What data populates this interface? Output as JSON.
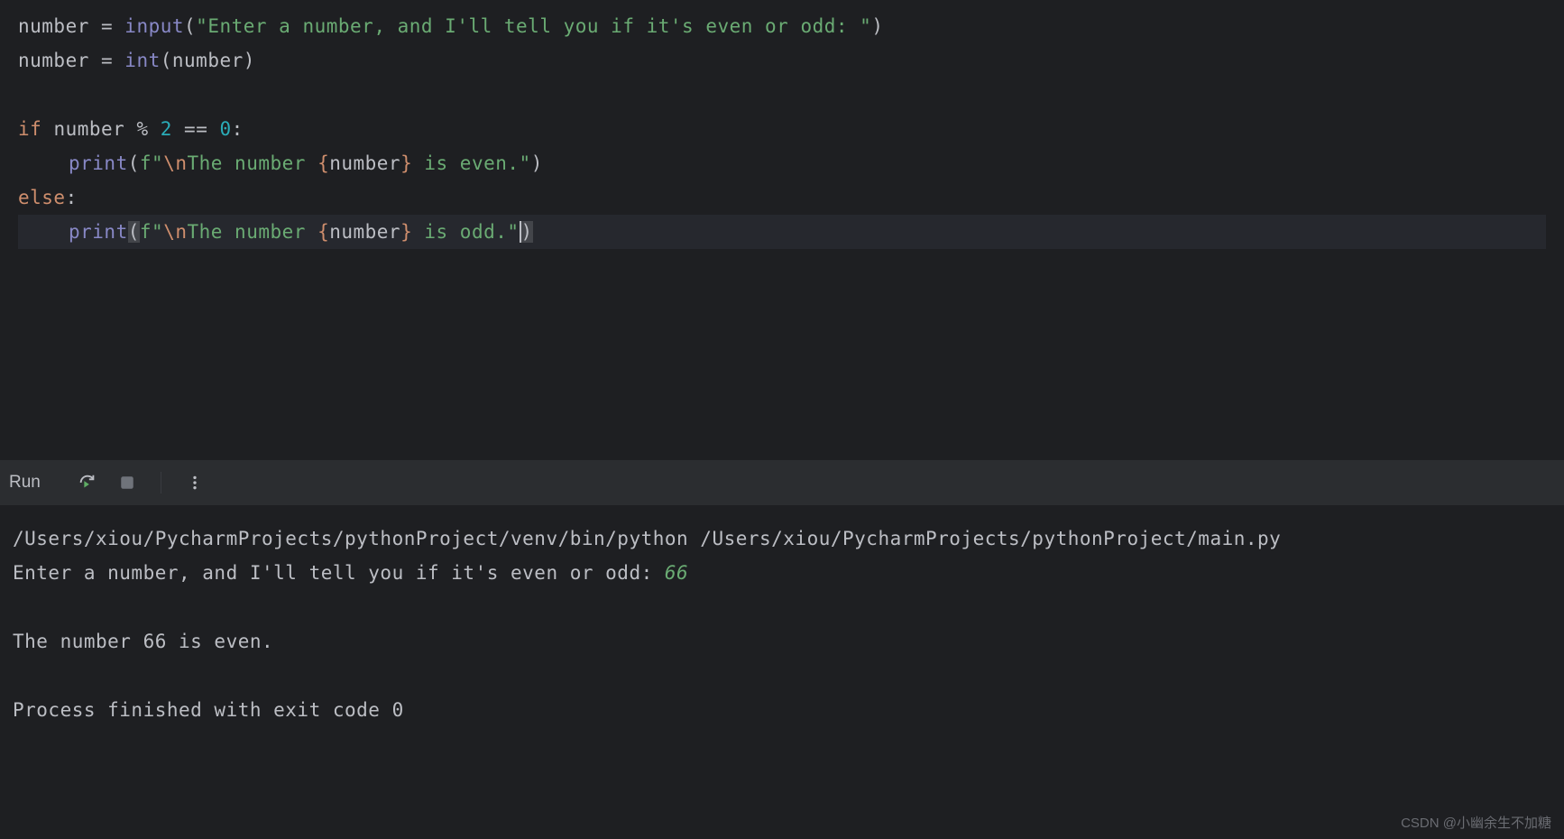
{
  "code": {
    "line1": {
      "var": "number",
      "op1": " = ",
      "builtin": "input",
      "string": "\"Enter a number, and I'll tell you if it's even or odd: \""
    },
    "line2": {
      "var": "number",
      "op1": " = ",
      "builtin": "int",
      "arg": "number"
    },
    "line4": {
      "kw": "if",
      "var": " number ",
      "op": "% ",
      "num1": "2",
      "eq": " == ",
      "num2": "0",
      "colon": ":"
    },
    "line5": {
      "builtin": "print",
      "fprefix": "f",
      "q1": "\"",
      "escape": "\\n",
      "text1": "The number ",
      "lbrace": "{",
      "fvar": "number",
      "rbrace": "}",
      "text2": " is even.",
      "q2": "\""
    },
    "line6": {
      "kw": "else",
      "colon": ":"
    },
    "line7": {
      "builtin": "print",
      "fprefix": "f",
      "q1": "\"",
      "escape": "\\n",
      "text1": "The number ",
      "lbrace": "{",
      "fvar": "number",
      "rbrace": "}",
      "text2": " is odd.",
      "q2": "\""
    }
  },
  "toolbar": {
    "run_label": "Run"
  },
  "console": {
    "cmd": "/Users/xiou/PycharmProjects/pythonProject/venv/bin/python /Users/xiou/PycharmProjects/pythonProject/main.py",
    "prompt": "Enter a number, and I'll tell you if it's even or odd: ",
    "user_input": "66",
    "output": "The number 66 is even.",
    "exit": "Process finished with exit code 0"
  },
  "watermark": "CSDN @小幽余生不加糖"
}
